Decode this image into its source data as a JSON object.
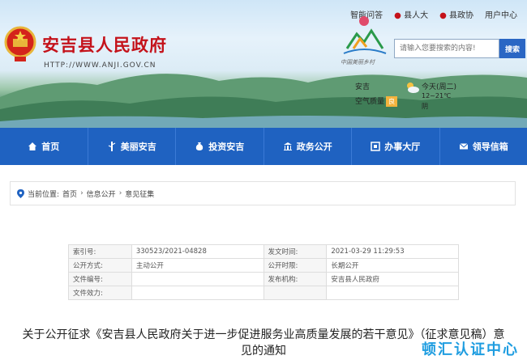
{
  "top_links": [
    "智能问答",
    "县人大",
    "县政协",
    "用户中心"
  ],
  "site": {
    "title": "安吉县人民政府",
    "url": "HTTP://WWW.ANJI.GOV.CN"
  },
  "logo_caption": "中国美丽乡村",
  "search": {
    "placeholder": "请输入您要搜索的内容!",
    "button": "搜索"
  },
  "weather": {
    "city": "安吉",
    "air_label": "空气质量",
    "air_badge": "良",
    "day": "今天(周二)",
    "temp": "12~21℃",
    "cond": "阴"
  },
  "nav": [
    {
      "label": "首页",
      "icon": "home-icon"
    },
    {
      "label": "美丽安吉",
      "icon": "bamboo-icon"
    },
    {
      "label": "投资安吉",
      "icon": "money-bag-icon"
    },
    {
      "label": "政务公开",
      "icon": "government-building-icon"
    },
    {
      "label": "办事大厅",
      "icon": "service-hall-icon"
    },
    {
      "label": "领导信箱",
      "icon": "mail-icon"
    }
  ],
  "breadcrumb": {
    "prefix": "当前位置:",
    "items": [
      "首页",
      "信息公开",
      "意见征集"
    ]
  },
  "info": {
    "rows": [
      {
        "k1": "索引号:",
        "v1": "330523/2021-04828",
        "k2": "发文时间:",
        "v2": "2021-03-29 11:29:53"
      },
      {
        "k1": "公开方式:",
        "v1": "主动公开",
        "k2": "公开时限:",
        "v2": "长期公开"
      },
      {
        "k1": "文件编号:",
        "v1": "",
        "k2": "发布机构:",
        "v2": "安吉县人民政府"
      },
      {
        "k1": "文件效力:",
        "v1": "",
        "k2": "",
        "v2": ""
      }
    ]
  },
  "article_title": "关于公开征求《安吉县人民政府关于进一步促进服务业高质量发展的若干意见》（征求意见稿）意见的通知",
  "watermark": "顿汇认证中心",
  "colors": {
    "nav_bg": "#1f62c1",
    "title_red": "#c4121a",
    "search_btn": "#2a66c4",
    "watermark": "#1f9de0"
  }
}
